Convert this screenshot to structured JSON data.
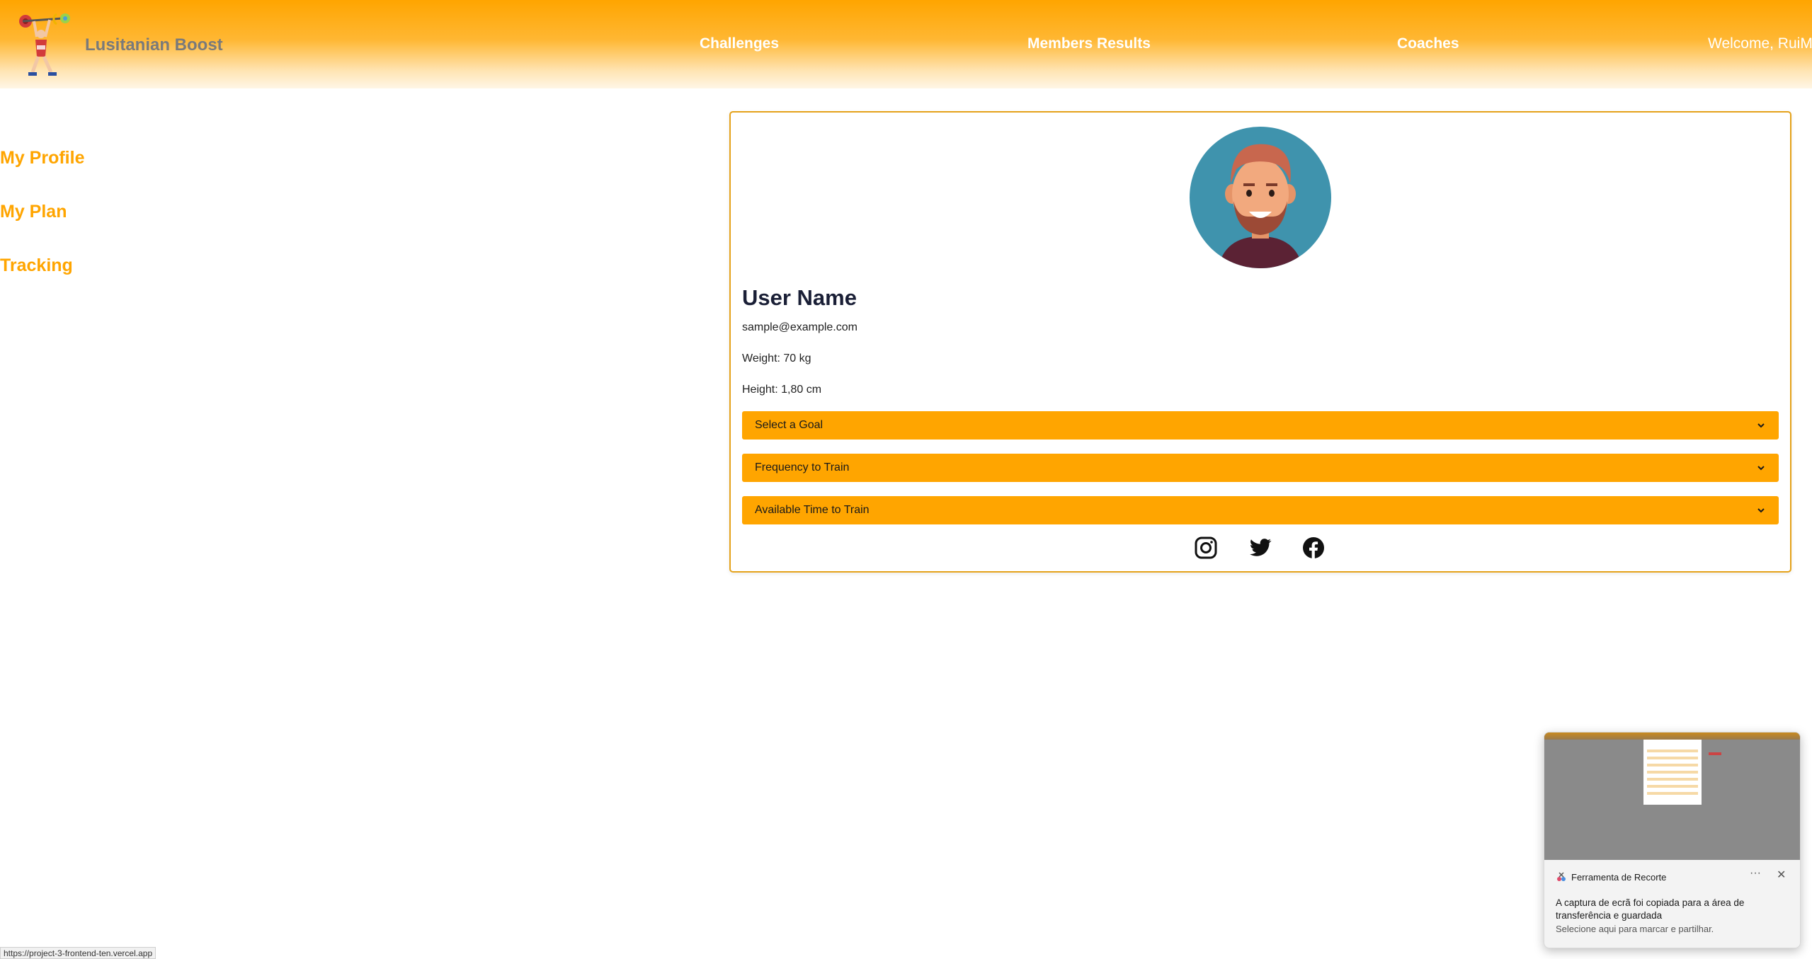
{
  "header": {
    "brand": "Lusitanian Boost",
    "nav": [
      "Challenges",
      "Members Results",
      "Coaches"
    ],
    "welcome": "Welcome, RuiM"
  },
  "sidebar": {
    "items": [
      "My Profile",
      "My Plan",
      "Tracking"
    ]
  },
  "profile": {
    "name": "User Name",
    "email": "sample@example.com",
    "weight": "Weight: 70 kg",
    "height": "Height: 1,80 cm",
    "selects": [
      "Select a Goal",
      "Frequency to Train",
      "Available Time to Train"
    ],
    "socials": [
      "instagram-icon",
      "twitter-icon",
      "facebook-icon"
    ]
  },
  "status_url": "https://project-3-frontend-ten.vercel.app",
  "toast": {
    "app": "Ferramenta de Recorte",
    "more": "···",
    "close": "✕",
    "message": "A captura de ecrã foi copiada para a área de transferência e guardada",
    "sub": "Selecione aqui para marcar e partilhar."
  },
  "colors": {
    "accent": "#ffa500",
    "title": "#1a1f36"
  }
}
